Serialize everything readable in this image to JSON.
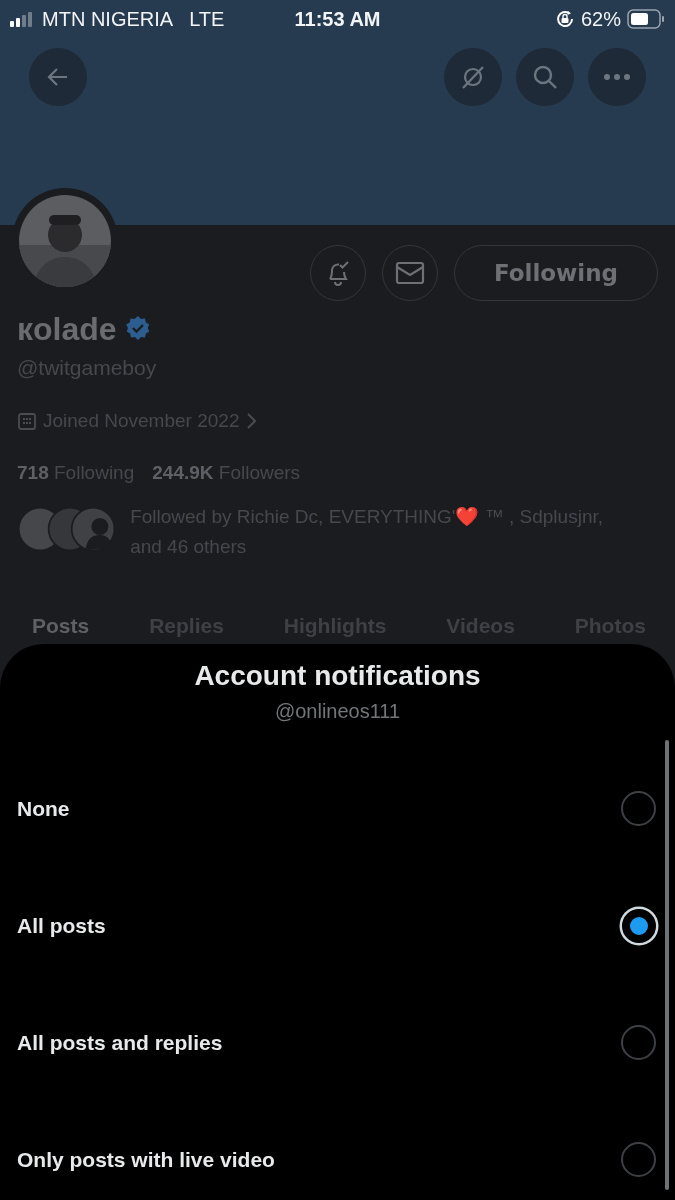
{
  "status_bar": {
    "carrier": "MTN NIGERIA",
    "network": "LTE",
    "time": "11:53 AM",
    "battery": "62%"
  },
  "profile": {
    "name": "кolade",
    "verified": true,
    "handle": "@twitgameboy",
    "joined": "Joined November 2022",
    "following_count": "718",
    "following_label": "Following",
    "followers_count": "244.9K",
    "followers_label": "Followers",
    "followed_by": "Followed by Richie Dc, EVERYTHING'❤️ ™ , Sdplusjnr, and 46 others",
    "follow_button": "Following"
  },
  "tabs": [
    {
      "label": "Posts",
      "selected": true
    },
    {
      "label": "Replies",
      "selected": false
    },
    {
      "label": "Highlights",
      "selected": false
    },
    {
      "label": "Videos",
      "selected": false
    },
    {
      "label": "Photos",
      "selected": false
    }
  ],
  "sheet": {
    "title": "Account notifications",
    "subtitle": "@onlineos111",
    "options": [
      {
        "label": "None",
        "selected": false
      },
      {
        "label": "All posts",
        "selected": true
      },
      {
        "label": "All posts and replies",
        "selected": false
      },
      {
        "label": "Only posts with live video",
        "selected": false
      }
    ]
  }
}
